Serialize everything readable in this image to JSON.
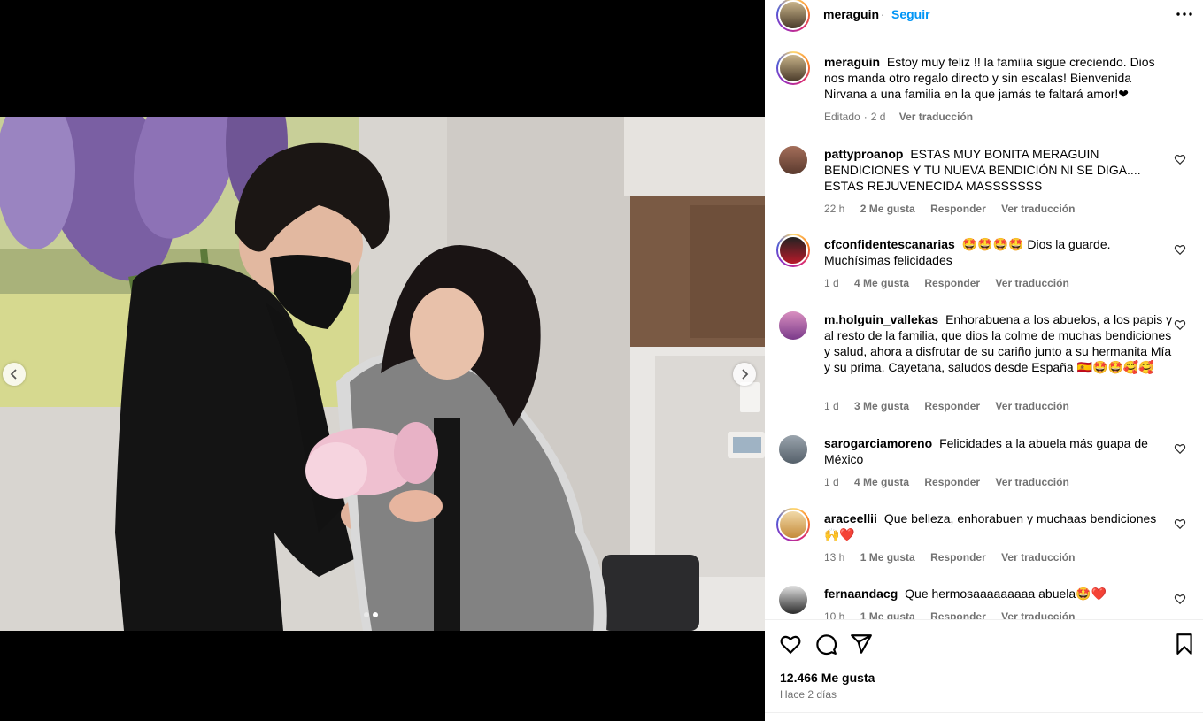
{
  "header": {
    "username": "meraguin",
    "separator": "·",
    "follow_label": "Seguir",
    "more_icon": "more-horizontal-icon"
  },
  "caption": {
    "username": "meraguin",
    "text": "Estoy muy feliz !! la familia sigue creciendo. Dios nos manda otro regalo directo y sin escalas! Bienvenida Nirvana a una familia en la que jamás te faltará amor!❤",
    "edited": "Editado",
    "time": "2 d",
    "translate": "Ver traducción"
  },
  "comments": [
    {
      "username": "pattyproanop",
      "text": "ESTAS MUY BONITA MERAGUIN BENDICIONES Y TU NUEVA BENDICIÓN NI SE DIGA.... ESTAS REJUVENECIDA MASSSSSSS",
      "time": "22 h",
      "likes": "2 Me gusta",
      "reply": "Responder",
      "translate": "Ver traducción"
    },
    {
      "username": "cfconfidentescanarias",
      "text": "🤩🤩🤩🤩 Dios la guarde. Muchísimas felicidades",
      "time": "1 d",
      "likes": "4 Me gusta",
      "reply": "Responder",
      "translate": "Ver traducción"
    },
    {
      "username": "m.holguin_vallekas",
      "text": "Enhorabuena a los abuelos, a los papis y al resto de la familia, que dios la colme de muchas bendiciones y salud, ahora a disfrutar de su cariño junto a su hermanita Mía y su prima, Cayetana, saludos desde España 🇪🇦🤩🤩🥰🥰",
      "time": "1 d",
      "likes": "3 Me gusta",
      "reply": "Responder",
      "translate": "Ver traducción"
    },
    {
      "username": "sarogarciamoreno",
      "text": "Felicidades a la abuela más guapa de México",
      "time": "1 d",
      "likes": "4 Me gusta",
      "reply": "Responder",
      "translate": "Ver traducción"
    },
    {
      "username": "araceellii",
      "text": "Que belleza, enhorabuen y muchaas bendiciones 🙌❤️",
      "time": "13 h",
      "likes": "1 Me gusta",
      "reply": "Responder",
      "translate": "Ver traducción"
    },
    {
      "username": "fernaandacg",
      "text": "Que hermosaaaaaaaaa abuela🤩❤️",
      "time": "10 h",
      "likes": "1 Me gusta",
      "reply": "Responder",
      "translate": "Ver traducción"
    }
  ],
  "footer": {
    "likes": "12.466 Me gusta",
    "posted": "Hace 2 días"
  },
  "icons": {
    "like": "heart-icon",
    "comment": "comment-icon",
    "share": "send-icon",
    "save": "bookmark-icon",
    "prev": "chevron-left-icon",
    "next": "chevron-right-icon"
  },
  "colors": {
    "accent": "#0095f6",
    "muted": "#737373",
    "divider": "#efefef"
  }
}
